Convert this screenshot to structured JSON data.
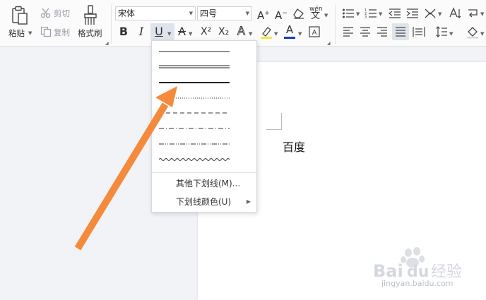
{
  "clipboard": {
    "paste_label": "粘贴",
    "cut_label": "剪切",
    "copy_label": "复制",
    "format_painter_label": "格式刷"
  },
  "font": {
    "family_value": "宋体",
    "size_value": "四号"
  },
  "format": {
    "bold": "B",
    "italic": "I",
    "underline": "U",
    "superscript": "X²",
    "subscript": "X₂",
    "font_color_letter": "A",
    "pinyin_label": "wén"
  },
  "underline_menu": {
    "styles": [
      "single",
      "double",
      "thick",
      "dotted",
      "dashed",
      "dash-dot",
      "dash-dot-dot",
      "wave"
    ],
    "more_label": "其他下划线(M)...",
    "color_label": "下划线颜色(U)"
  },
  "document": {
    "body_text": "百度"
  },
  "watermark": {
    "brand": "Baidu",
    "cn": "经验",
    "url": "jingyan.baidu.com"
  },
  "colors": {
    "annotation_arrow": "#f58a3d",
    "highlight": "#f5e642",
    "font_color_bar": "#1d39c4",
    "active_button": "#dfe4ec"
  }
}
